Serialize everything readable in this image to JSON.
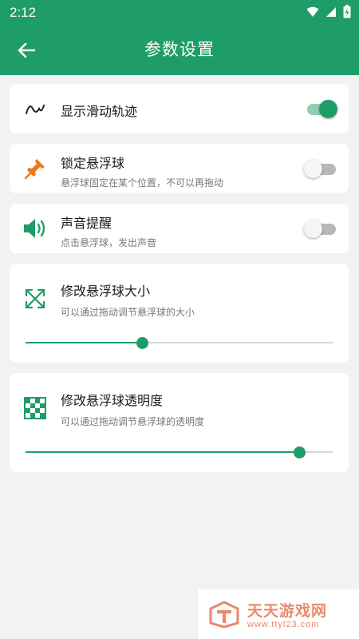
{
  "status": {
    "time": "2:12"
  },
  "header": {
    "title": "参数设置"
  },
  "settings": {
    "trail": {
      "label": "显示滑动轨迹",
      "enabled": true
    },
    "lock": {
      "label": "锁定悬浮球",
      "desc": "悬浮球固定在某个位置，不可以再拖动",
      "enabled": false
    },
    "sound": {
      "label": "声音提醒",
      "desc": "点击悬浮球，发出声音",
      "enabled": false
    },
    "size": {
      "label": "修改悬浮球大小",
      "desc": "可以通过拖动调节悬浮球的大小",
      "value": 0.38
    },
    "opacity": {
      "label": "修改悬浮球透明度",
      "desc": "可以通过拖动调节悬浮球的透明度",
      "value": 0.89
    }
  },
  "watermark": {
    "name": "天天游戏网",
    "url": "www.ttyl23.com"
  },
  "colors": {
    "accent": "#1f9d68",
    "pin": "#f07a1a"
  }
}
